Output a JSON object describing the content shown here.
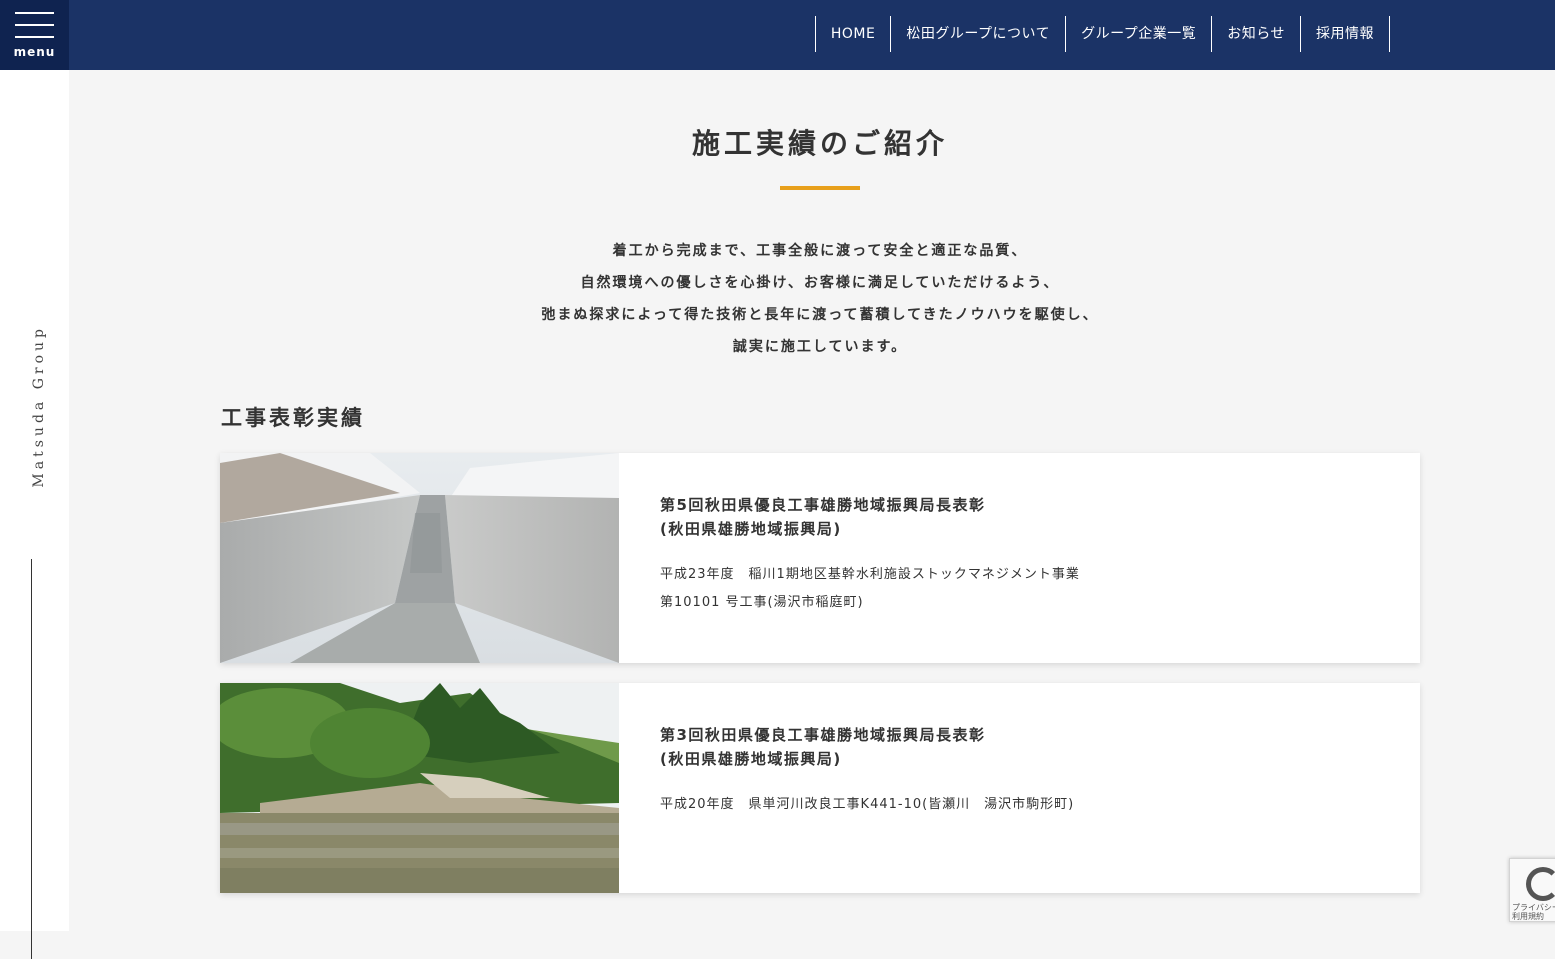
{
  "header": {
    "menu_label": "menu",
    "nav": [
      "HOME",
      "松田グループについて",
      "グループ企業一覧",
      "お知らせ",
      "採用情報"
    ]
  },
  "side": {
    "brand": "Matsuda Group"
  },
  "main": {
    "title": "施工実績のご紹介",
    "lead": [
      "着工から完成まで、工事全般に渡って安全と適正な品質、",
      "自然環境への優しさを心掛け、お客様に満足していただけるよう、",
      "弛まぬ探求によって得た技術と長年に渡って蓄積してきたノウハウを駆使し、",
      "誠実に施工しています。"
    ],
    "section_title": "工事表彰実績",
    "cards": [
      {
        "heading1": "第5回秋田県優良工事雄勝地域振興局長表彰",
        "heading2": "(秋田県雄勝地域振興局)",
        "desc1": "平成23年度　稲川1期地区基幹水利施設ストックマネジメント事業",
        "desc2": "第10101 号工事(湯沢市稲庭町)"
      },
      {
        "heading1": "第3回秋田県優良工事雄勝地域振興局長表彰",
        "heading2": "(秋田県雄勝地域振興局)",
        "desc1": "平成20年度　県単河川改良工事K441-10(皆瀬川　湯沢市駒形町)"
      }
    ]
  },
  "recaptcha": {
    "text1": "プライバシー",
    "text2": "利用規約"
  },
  "colors": {
    "header": "#1b3366",
    "menu": "#0f2350",
    "accent": "#e8a01c",
    "background": "#f5f5f5"
  }
}
